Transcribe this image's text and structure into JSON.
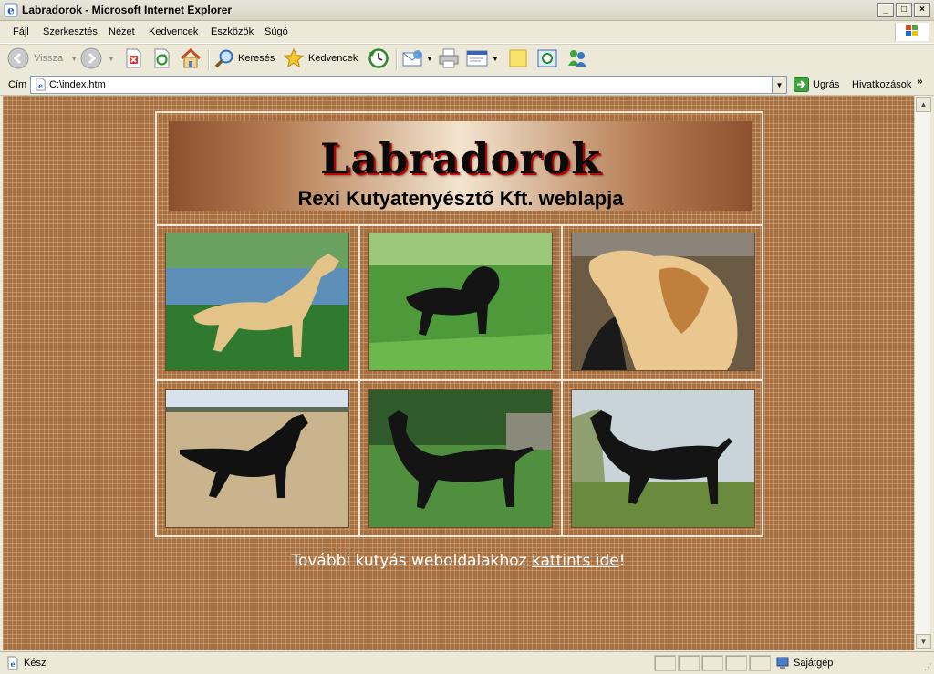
{
  "window": {
    "title": "Labradorok - Microsoft Internet Explorer",
    "min_label": "_",
    "max_label": "□",
    "close_label": "×"
  },
  "menu": {
    "items": [
      "Fájl",
      "Szerkesztés",
      "Nézet",
      "Kedvencek",
      "Eszközök",
      "Súgó"
    ]
  },
  "toolbar": {
    "back_label": "Vissza",
    "search_label": "Keresés",
    "favorites_label": "Kedvencek"
  },
  "address": {
    "label": "Cím",
    "url": "C:\\index.htm",
    "go_label": "Ugrás",
    "links_label": "Hivatkozások"
  },
  "page": {
    "banner_title": "Labradorok",
    "banner_subtitle": "Rexi Kutyatenyésztő Kft. weblapja",
    "photos": [
      {
        "icon": "yellow-labrador-by-pond"
      },
      {
        "icon": "black-labrador-puppy-in-grass"
      },
      {
        "icon": "yellow-labrador-head-closeup"
      },
      {
        "icon": "black-labrador-in-field"
      },
      {
        "icon": "black-labrador-on-lawn"
      },
      {
        "icon": "black-labrador-by-water"
      }
    ],
    "footer_prefix": "További kutyás weboldalakhoz ",
    "footer_link": "kattints ide",
    "footer_suffix": "!"
  },
  "status": {
    "text": "Kész",
    "zone": "Sajátgép"
  },
  "colors": {
    "page_bg": "#A87040",
    "grid_lines": "#F3E7D8",
    "footer_text": "#FFFFFF"
  }
}
